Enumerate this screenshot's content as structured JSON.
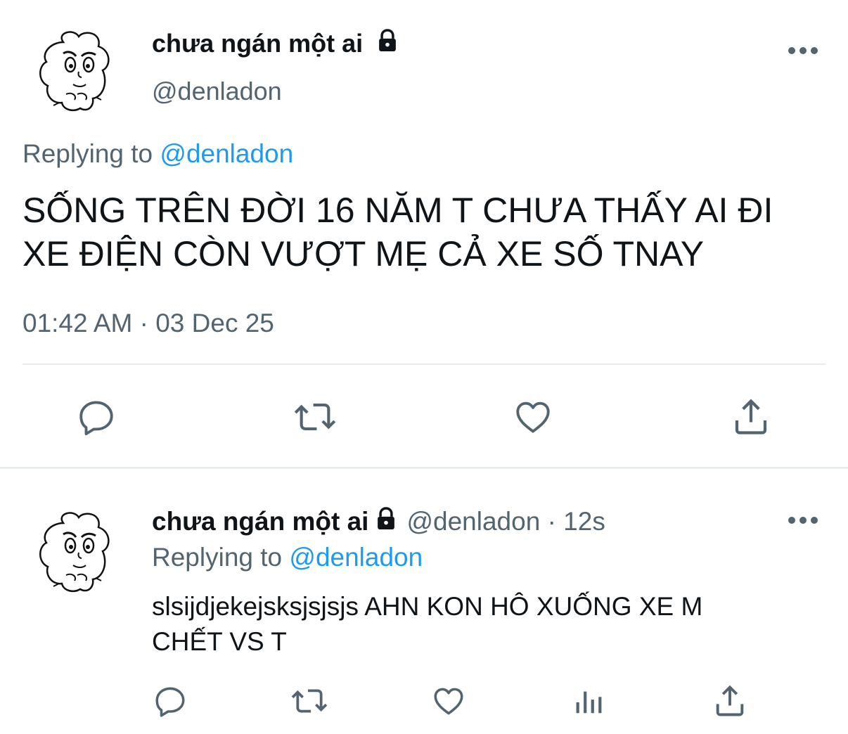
{
  "main_tweet": {
    "display_name": "chưa ngán một ai",
    "handle": "@denladon",
    "replying_prefix": "Replying to",
    "replying_handle": "@denladon",
    "text_line1": "SỐNG TRÊN ĐỜI 16 NĂM T CHƯA THẤY AI ĐI",
    "text_line2": "XE ĐIỆN CÒN VƯỢT MẸ CẢ XE SỐ TNAY",
    "timestamp": "01:42 AM · 03 Dec 25",
    "actions": [
      "reply-icon",
      "retweet-icon",
      "like-icon",
      "share-icon"
    ]
  },
  "reply_tweet": {
    "display_name": "chưa ngán một ai",
    "handle": "@denladon",
    "separator": "·",
    "time_ago": "12s",
    "replying_prefix": "Replying to",
    "replying_handle": "@denladon",
    "text_line1": "slsijdjekejsksjsjsjs AHN KON HÔ XUỐNG XE M",
    "text_line2": "CHẾT VS T",
    "actions": [
      "reply-icon",
      "retweet-icon",
      "like-icon",
      "analytics-icon",
      "share-icon"
    ]
  },
  "colors": {
    "text": "#0f1419",
    "muted": "#536471",
    "link": "#1d9bf0",
    "divider": "#eff3f4"
  }
}
